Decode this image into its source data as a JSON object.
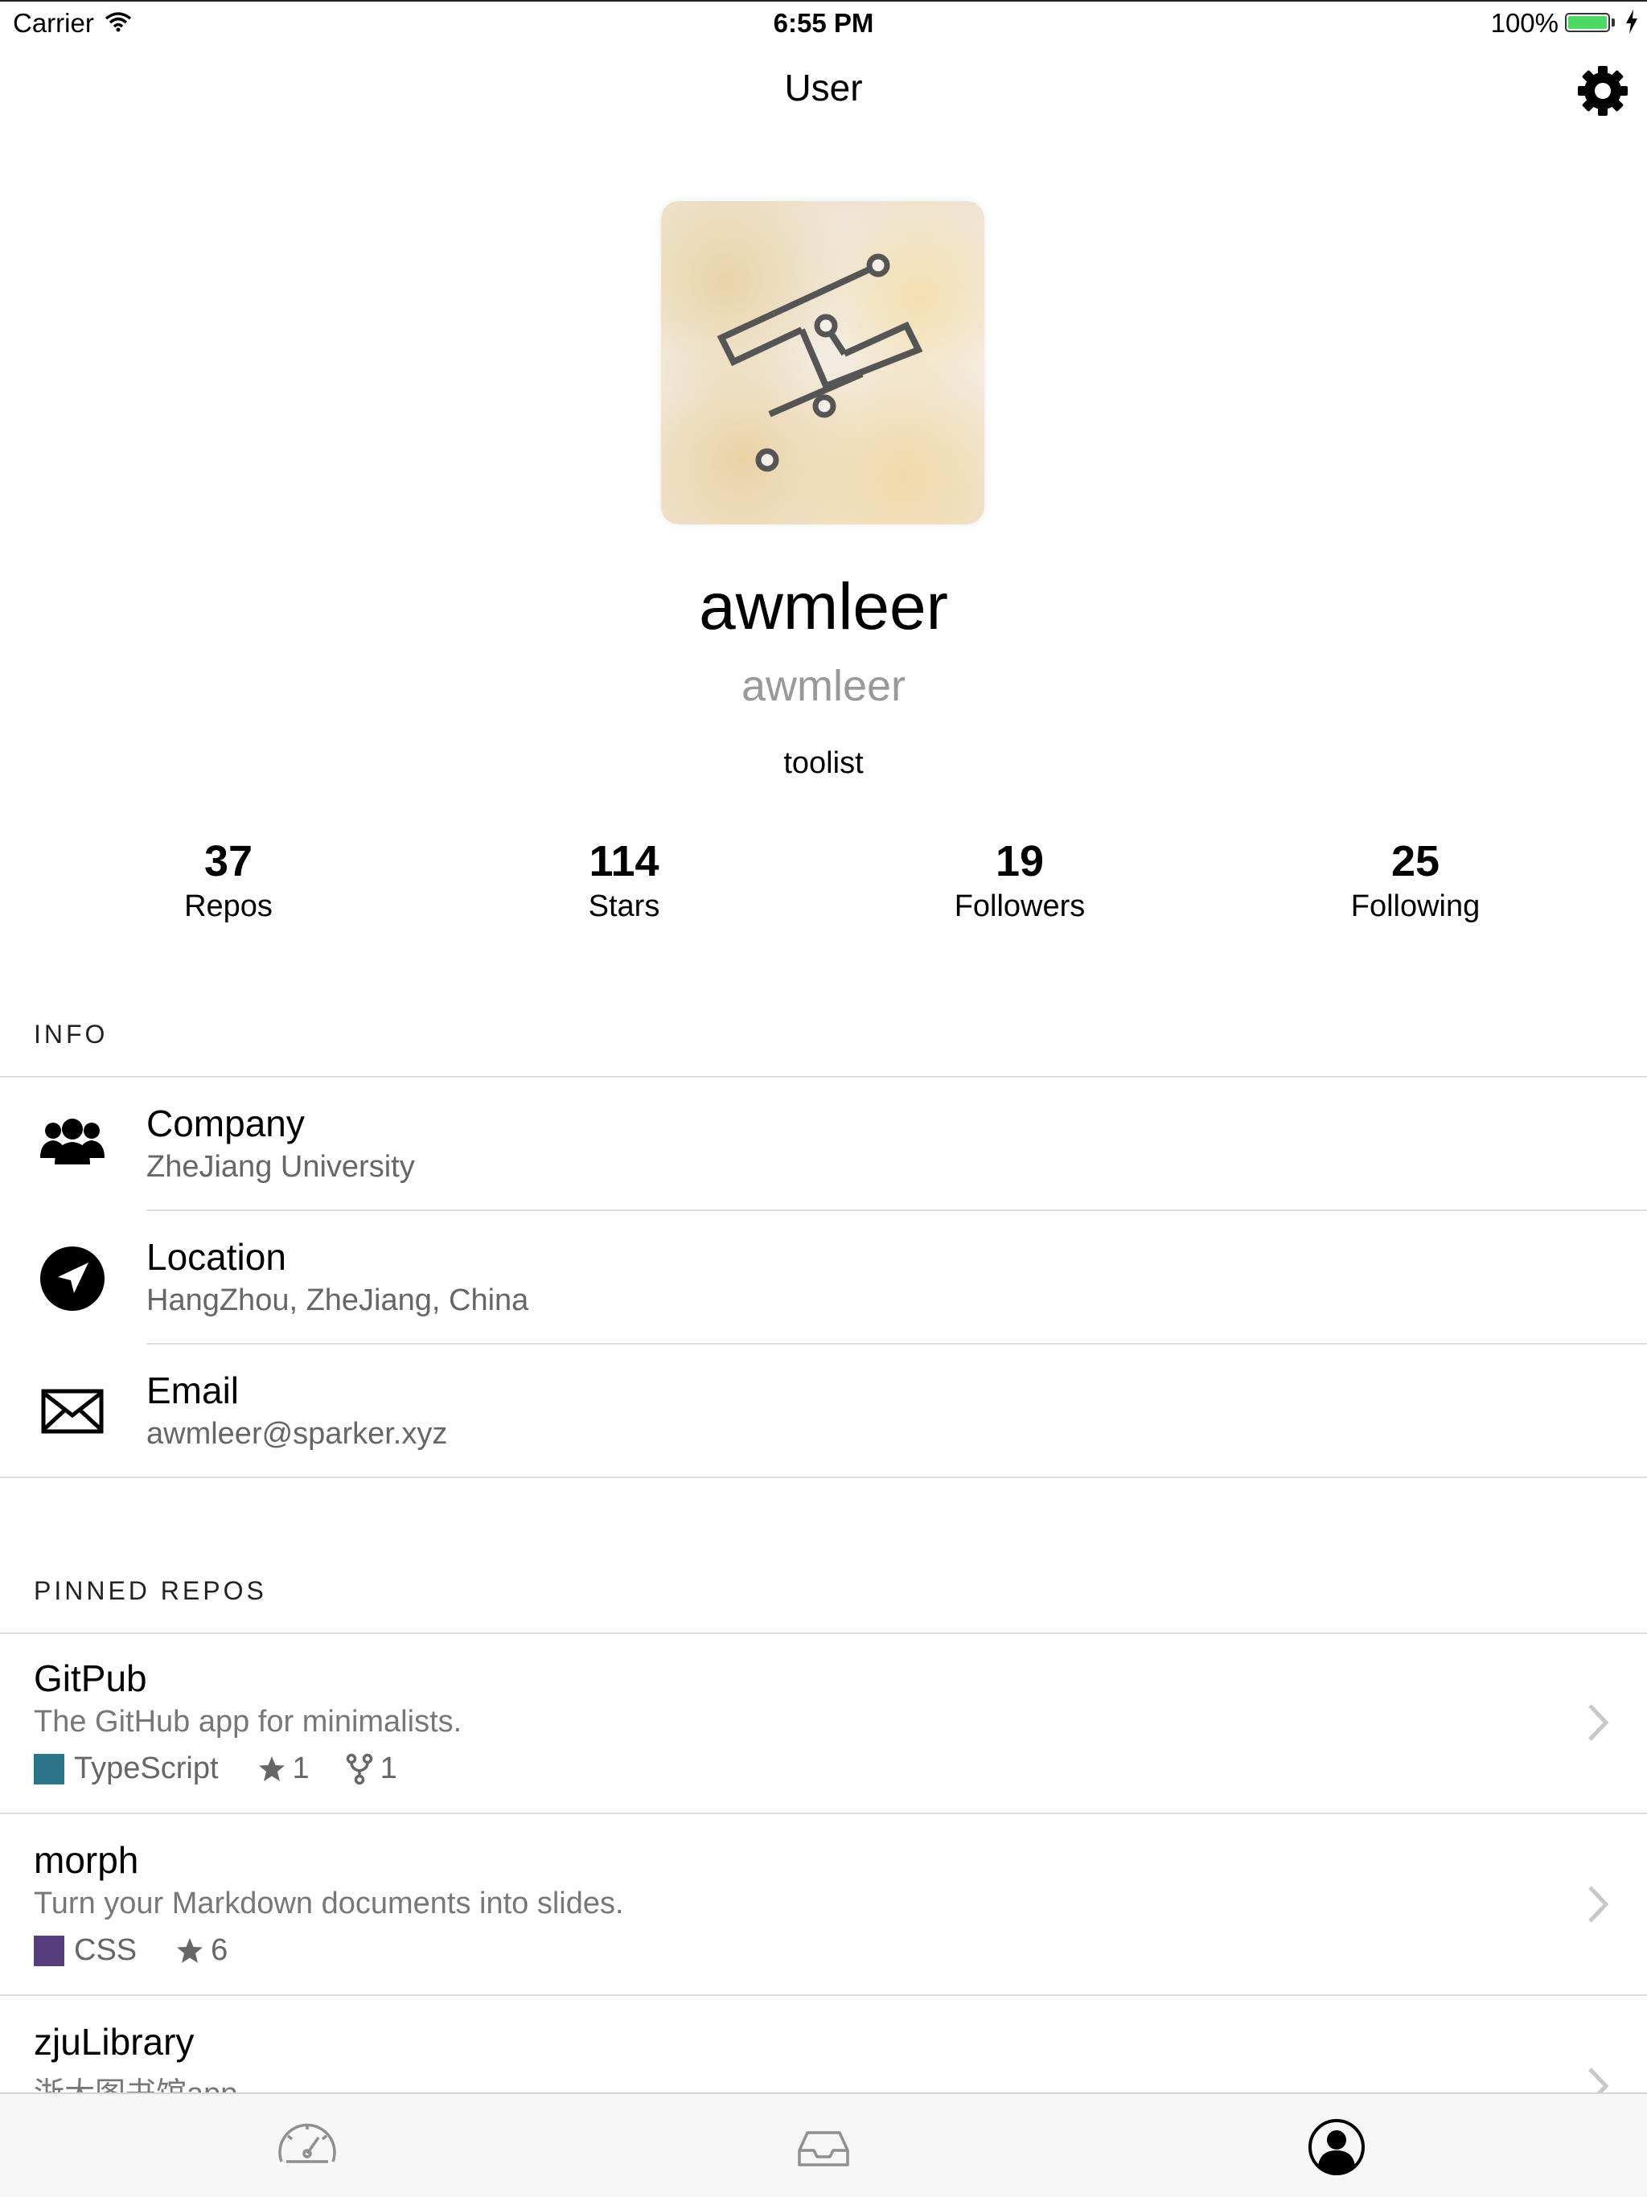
{
  "status_bar": {
    "carrier": "Carrier",
    "time": "6:55 PM",
    "battery": "100%"
  },
  "nav": {
    "title": "User",
    "settings_icon": "gear-icon"
  },
  "profile": {
    "avatar_icon": "logo-avatar",
    "name": "awmleer",
    "login": "awmleer",
    "bio": "toolist"
  },
  "stats": [
    {
      "count": "37",
      "label": "Repos"
    },
    {
      "count": "114",
      "label": "Stars"
    },
    {
      "count": "19",
      "label": "Followers"
    },
    {
      "count": "25",
      "label": "Following"
    }
  ],
  "info": {
    "header": "INFO",
    "items": [
      {
        "icon": "people-icon",
        "title": "Company",
        "value": "ZheJiang University"
      },
      {
        "icon": "location-arrow-icon",
        "title": "Location",
        "value": "HangZhou, ZheJiang, China"
      },
      {
        "icon": "envelope-icon",
        "title": "Email",
        "value": "awmleer@sparker.xyz"
      }
    ]
  },
  "pinned": {
    "header": "PINNED REPOS",
    "repos": [
      {
        "name": "GitPub",
        "description": "The GitHub app for minimalists.",
        "language": "TypeScript",
        "language_color": "#2b7489",
        "stars": "1",
        "forks": "1"
      },
      {
        "name": "morph",
        "description": "Turn your Markdown documents into slides.",
        "language": "CSS",
        "language_color": "#563d7c",
        "stars": "6"
      },
      {
        "name": "zjuLibrary",
        "description": "浙大图书馆app"
      }
    ]
  },
  "tabs": [
    {
      "icon": "dashboard-icon"
    },
    {
      "icon": "inbox-icon"
    },
    {
      "icon": "user-profile-icon",
      "active": true
    }
  ],
  "colors": {
    "swatch_ts": "#2b7489",
    "swatch_css": "#563d7c",
    "battery": "#4cd964"
  }
}
